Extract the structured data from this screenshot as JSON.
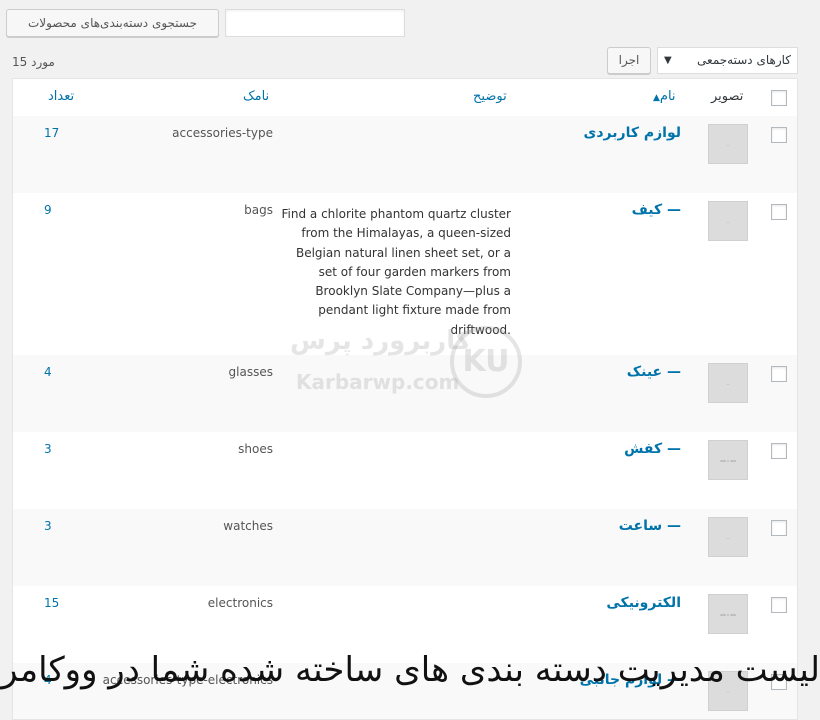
{
  "search": {
    "button_label": "جستجوی دسته‌بندی‌های محصولات",
    "value": "",
    "placeholder": ""
  },
  "bulk": {
    "selected": "کارهای دسته‌جمعی",
    "apply_label": "اجرا"
  },
  "items_count": "15 مورد",
  "columns": {
    "image": "تصویر",
    "name": "نام",
    "description": "توضیح",
    "slug": "نامک",
    "count": "تعداد"
  },
  "rows": [
    {
      "name": "لوازم کاربردی",
      "description": "",
      "slug": "accessories-type",
      "count": "17",
      "thumb": "—"
    },
    {
      "name": "— کیف",
      "description": "Find a chlorite phantom quartz cluster from the Himalayas, a queen-sized Belgian natural linen sheet set, or a set of four garden markers from Brooklyn Slate Company—plus a pendant light fixture made from driftwood.",
      "slug": "bags",
      "count": "9",
      "thumb": "—"
    },
    {
      "name": "— عینک",
      "description": "",
      "slug": "glasses",
      "count": "4",
      "thumb": "—"
    },
    {
      "name": "— کفش",
      "description": "",
      "slug": "shoes",
      "count": "3",
      "thumb": "200 × 200"
    },
    {
      "name": "— ساعت",
      "description": "",
      "slug": "watches",
      "count": "3",
      "thumb": "—"
    },
    {
      "name": "الکترونیکی",
      "description": "",
      "slug": "electronics",
      "count": "15",
      "thumb": "200 × 200"
    },
    {
      "name": "— لوازم جانبی",
      "description": "",
      "slug": "accessories-type-electronics",
      "count": "4",
      "thumb": "—"
    }
  ],
  "watermark": {
    "brand_fa": "کاربرورد پرس",
    "brand_en": "Karbarwp.com",
    "logo": "KU"
  },
  "caption": "لیست مدیریت دسته بندی های ساخته شده شما در ووکامرس"
}
